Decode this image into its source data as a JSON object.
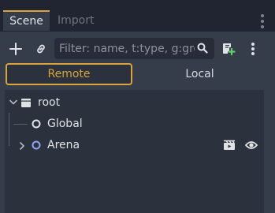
{
  "tabs": [
    {
      "label": "Scene",
      "active": true
    },
    {
      "label": "Import",
      "active": false
    }
  ],
  "filter": {
    "value": "",
    "placeholder": "Filter: name, t:type, g:gro"
  },
  "mode": {
    "remote_label": "Remote",
    "local_label": "Local",
    "selected": "Remote"
  },
  "tree": {
    "root": {
      "label": "root",
      "icon": "node-folder-icon"
    },
    "children": [
      {
        "label": "Global",
        "icon": "node-circle-icon",
        "icon_color": "#e0e2e6",
        "expandable": false
      },
      {
        "label": "Arena",
        "icon": "node-circle-icon",
        "icon_color": "#8da5f3",
        "expandable": true
      }
    ]
  },
  "colors": {
    "accent": "#d9a53a",
    "node_2d": "#8da5f3",
    "background": "#202531",
    "panel": "#363d4a"
  }
}
